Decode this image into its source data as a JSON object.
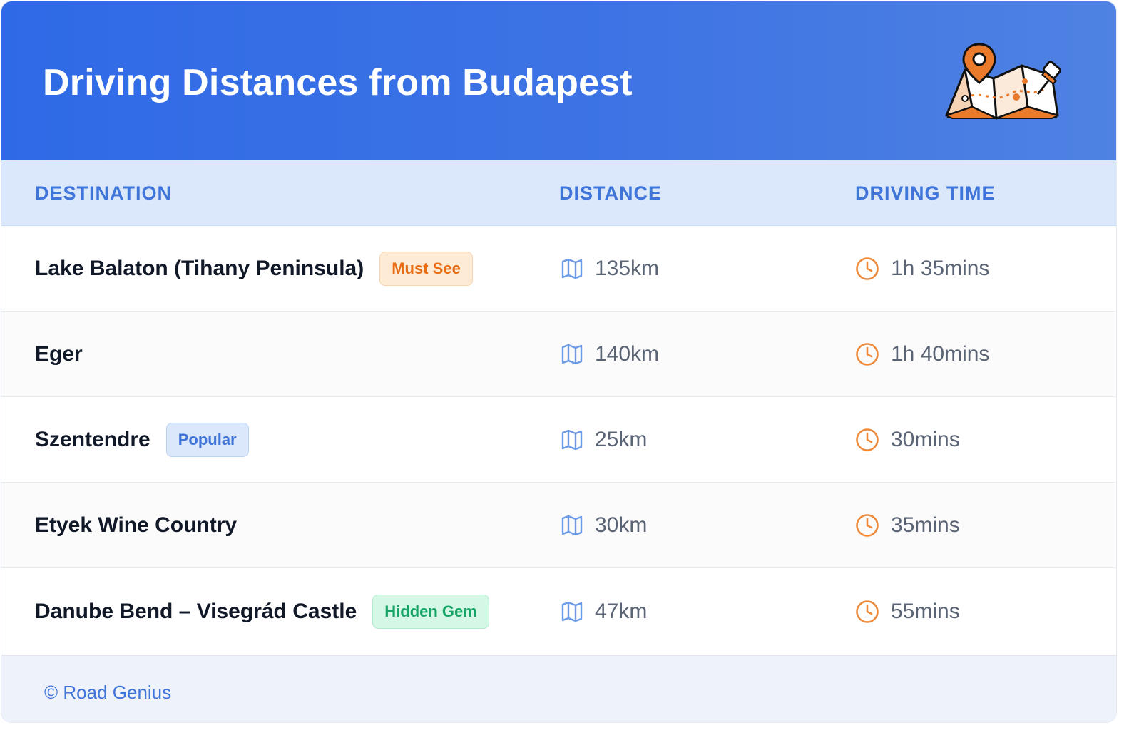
{
  "header": {
    "title": "Driving Distances from Budapest"
  },
  "columns": {
    "destination": "DESTINATION",
    "distance": "DISTANCE",
    "driving_time": "DRIVING TIME"
  },
  "rows": [
    {
      "destination": "Lake Balaton (Tihany Peninsula)",
      "badge": "Must See",
      "badge_style": "orange",
      "distance": "135km",
      "time": "1h 35mins"
    },
    {
      "destination": "Eger",
      "badge": "",
      "badge_style": "",
      "distance": "140km",
      "time": "1h 40mins"
    },
    {
      "destination": "Szentendre",
      "badge": "Popular",
      "badge_style": "blue",
      "distance": "25km",
      "time": "30mins"
    },
    {
      "destination": "Etyek Wine Country",
      "badge": "",
      "badge_style": "",
      "distance": "30km",
      "time": "35mins"
    },
    {
      "destination": "Danube Bend – Visegrád Castle",
      "badge": "Hidden Gem",
      "badge_style": "green",
      "distance": "47km",
      "time": "55mins"
    }
  ],
  "icons": {
    "distance": "map-icon",
    "time": "clock-icon",
    "header": "map-pin-illustration"
  },
  "colors": {
    "header_start": "#2f6ae6",
    "header_end": "#4f82e2",
    "accent_blue": "#3f74d9",
    "accent_orange": "#ee8a3a",
    "badge_orange_bg": "#fdebd6",
    "badge_orange_text": "#ea6c12",
    "badge_blue_bg": "#dbe8fc",
    "badge_blue_text": "#3f74d9",
    "badge_green_bg": "#d4f7e6",
    "badge_green_text": "#17a567"
  },
  "footer": {
    "text": "© Road Genius"
  }
}
